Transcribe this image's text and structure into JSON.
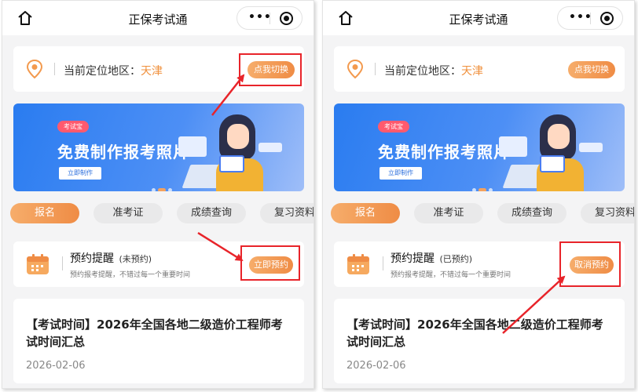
{
  "phones": [
    {
      "title": "正保考试通",
      "capsule_dots": "•••",
      "location_label": "当前定位地区：",
      "location_city": "天津",
      "switch_button": "点我切换",
      "banner": {
        "tag": "考试宝",
        "title": "免费制作报考照片",
        "button": "立即制作"
      },
      "tabs": [
        "报名",
        "准考证",
        "成绩查询",
        "复习资料"
      ],
      "reminder": {
        "title": "预约提醒",
        "status": "(未预约)",
        "subtitle": "预约报考提醒，不错过每一个重要时间",
        "button": "立即预约"
      },
      "article": {
        "title": "【考试时间】2026年全国各地二级造价工程师考试时间汇总",
        "date": "2026-02-06"
      }
    },
    {
      "title": "正保考试通",
      "capsule_dots": "•••",
      "location_label": "当前定位地区：",
      "location_city": "天津",
      "switch_button": "点我切换",
      "banner": {
        "tag": "考试宝",
        "title": "免费制作报考照片",
        "button": "立即制作"
      },
      "tabs": [
        "报名",
        "准考证",
        "成绩查询",
        "复习资料"
      ],
      "reminder": {
        "title": "预约提醒",
        "status": "(已预约)",
        "subtitle": "预约报考提醒，不错过每一个重要时间",
        "button": "取消预约"
      },
      "article": {
        "title": "【考试时间】2026年全国各地二级造价工程师考试时间汇总",
        "date": "2026-02-06"
      }
    }
  ],
  "colors": {
    "accent": "#ef8c45",
    "city": "#f0903c",
    "banner_blue": "#2a7cf0",
    "highlight": "#e8242a"
  },
  "icons": [
    "home-icon",
    "more-dots-icon",
    "target-icon",
    "location-pin-icon",
    "calendar-icon"
  ]
}
